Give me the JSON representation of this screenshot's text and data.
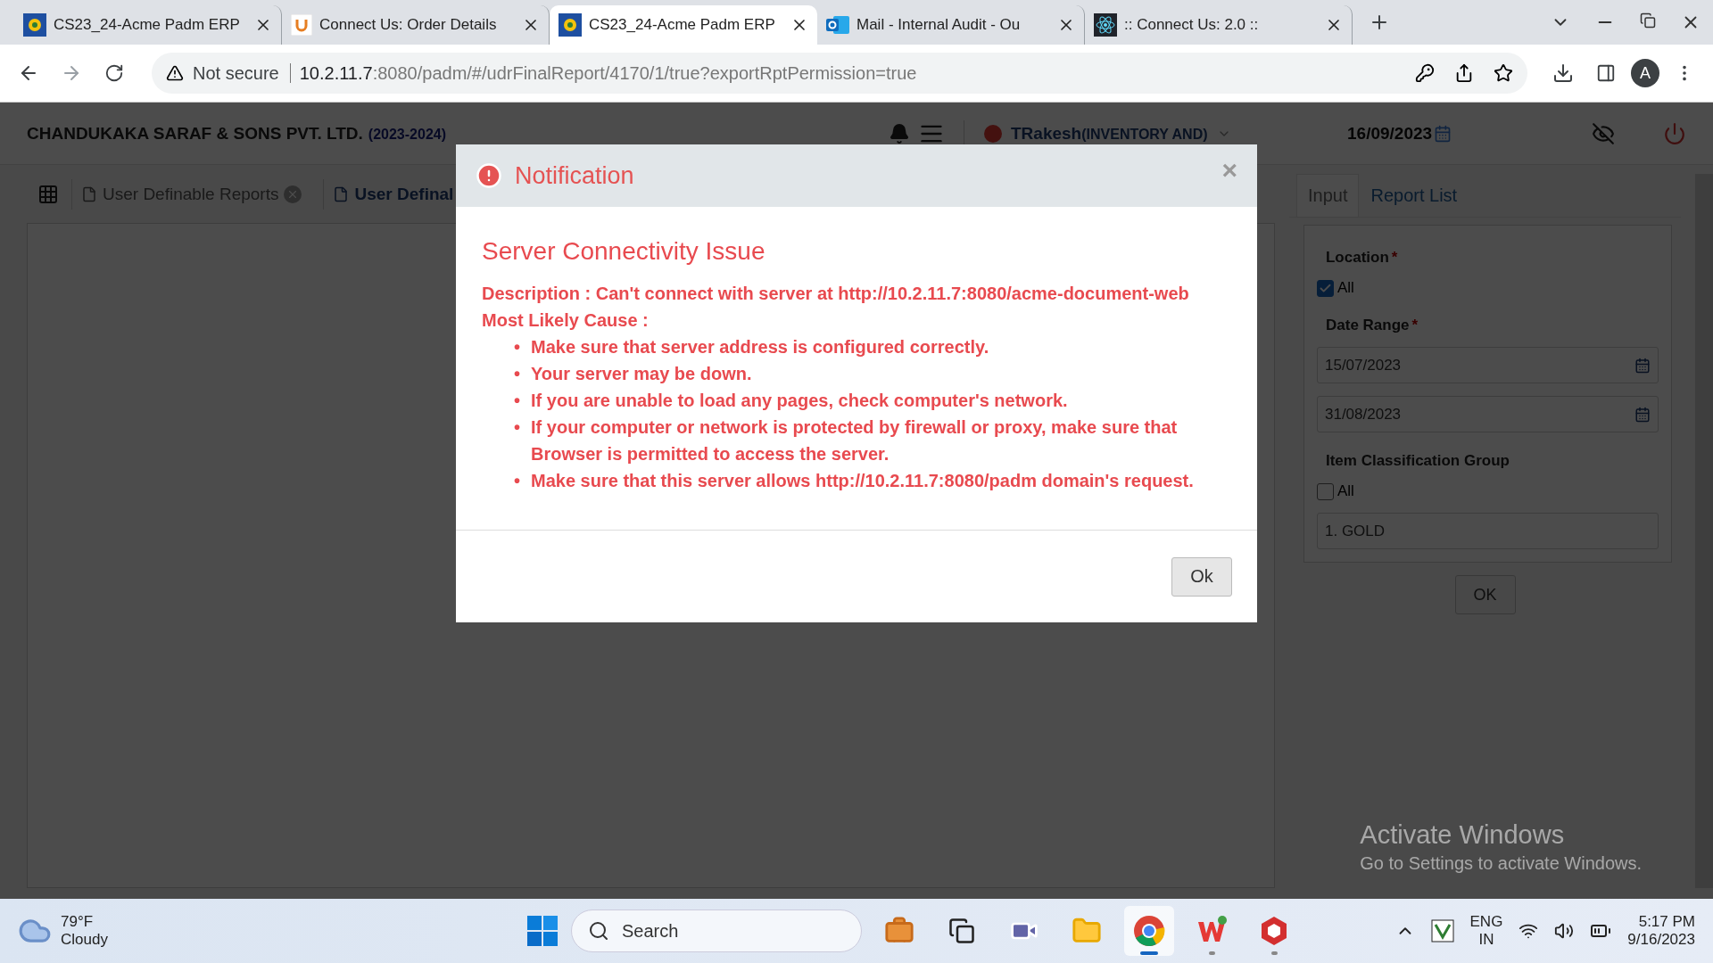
{
  "browser": {
    "tabs": [
      {
        "title": "CS23_24-Acme Padm ERP",
        "kind": "erp",
        "selected": false
      },
      {
        "title": "Connect Us: Order Details",
        "kind": "connect",
        "selected": false
      },
      {
        "title": "CS23_24-Acme Padm ERP",
        "kind": "erp",
        "selected": true
      },
      {
        "title": "Mail - Internal Audit - Ou",
        "kind": "mail",
        "selected": false
      },
      {
        "title": ":: Connect Us: 2.0 ::",
        "kind": "atom",
        "selected": false
      }
    ],
    "security": "Not secure",
    "url_host": "10.2.11.7",
    "url_path": ":8080/padm/#/udrFinalReport/4170/1/true?exportRptPermission=true",
    "profile": "A"
  },
  "app": {
    "company": "CHANDUKAKA SARAF & SONS PVT. LTD.",
    "year": "(2023-2024)",
    "user": "TRakesh",
    "role": "(INVENTORY AND)",
    "date": "16/09/2023",
    "page_tabs": [
      {
        "label": "User Definable Reports",
        "selected": false,
        "closable": true
      },
      {
        "label": "User Definal",
        "selected": true
      }
    ],
    "required_mark": "*",
    "panel_tabs": [
      {
        "label": "Input",
        "selected": true
      },
      {
        "label": "Report List",
        "selected": false
      }
    ],
    "form": [
      {
        "kind": "label",
        "text": "Location",
        "required": true
      },
      {
        "kind": "checkbox",
        "label": "All",
        "checked": true
      },
      {
        "kind": "label",
        "text": "Date Range",
        "required": true
      },
      {
        "kind": "date",
        "value": "15/07/2023"
      },
      {
        "kind": "date",
        "value": "31/08/2023"
      },
      {
        "kind": "label",
        "text": "Item Classification Group",
        "required": false
      },
      {
        "kind": "checkbox",
        "label": "All",
        "checked": false
      },
      {
        "kind": "select",
        "value": "1. GOLD"
      }
    ],
    "submit": "OK"
  },
  "dialog": {
    "title": "Notification",
    "close": "×",
    "heading": "Server Connectivity Issue",
    "description": "Description : Can't connect with server at http://10.2.11.7:8080/acme-document-web",
    "cause_label": "Most Likely Cause :",
    "bullet": "•",
    "causes": [
      "Make sure that server address is configured correctly.",
      "Your server may be down.",
      "If you are unable to load any pages, check computer's network.",
      "If your computer or network is protected by firewall or proxy, make sure that Browser is permitted to access the server.",
      "Make sure that this server allows http://10.2.11.7:8080/padm domain's request."
    ],
    "button": "Ok"
  },
  "activation": {
    "title": "Activate Windows",
    "subtitle": "Go to Settings to activate Windows."
  },
  "taskbar": {
    "temperature": "79°F",
    "condition": "Cloudy",
    "search": "Search",
    "apps": [
      {
        "kind": "briefcase",
        "selected": false,
        "running": false
      },
      {
        "kind": "taskview",
        "selected": false,
        "running": false
      },
      {
        "kind": "meet",
        "selected": false,
        "running": false
      },
      {
        "kind": "folder",
        "selected": false,
        "running": false
      },
      {
        "kind": "browser",
        "selected": true,
        "running": true
      },
      {
        "kind": "office",
        "selected": false,
        "running": true
      },
      {
        "kind": "redapp",
        "selected": false,
        "running": true
      }
    ],
    "language": "ENG",
    "region": "IN",
    "time": "5:17 PM",
    "date": "9/16/2023"
  }
}
